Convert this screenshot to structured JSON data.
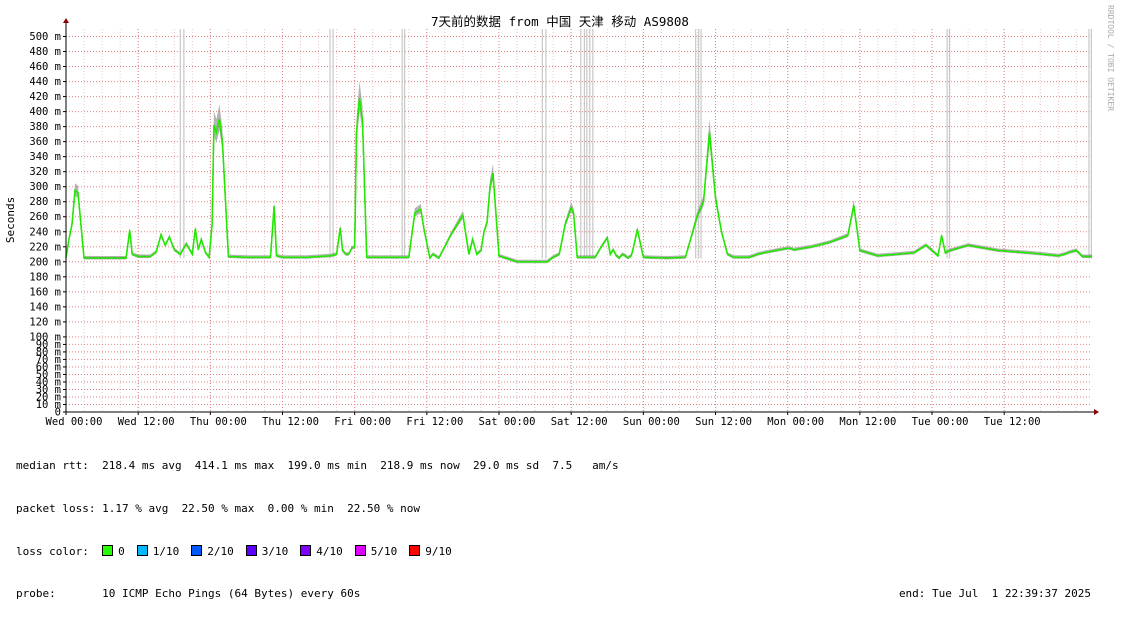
{
  "chart_data": {
    "type": "line",
    "title": "7天前的数据 from 中国 天津 移动 AS9808",
    "ylabel": "Seconds",
    "xlabel": "",
    "watermark": "RRDTOOL / TOBI OETIKER",
    "ylim": [
      0,
      510
    ],
    "yticks": [
      0,
      10,
      20,
      30,
      40,
      50,
      60,
      70,
      80,
      90,
      100,
      120,
      140,
      160,
      180,
      200,
      220,
      240,
      260,
      280,
      300,
      320,
      340,
      360,
      380,
      400,
      420,
      440,
      460,
      480,
      500
    ],
    "ytick_labels": [
      "0",
      "10 m",
      "20 m",
      "30 m",
      "40 m",
      "50 m",
      "60 m",
      "70 m",
      "80 m",
      "90 m",
      "100 m",
      "120 m",
      "140 m",
      "160 m",
      "180 m",
      "200 m",
      "220 m",
      "240 m",
      "260 m",
      "280 m",
      "300 m",
      "320 m",
      "340 m",
      "360 m",
      "380 m",
      "400 m",
      "420 m",
      "440 m",
      "460 m",
      "480 m",
      "500 m"
    ],
    "xlim_hours": [
      0,
      170.6
    ],
    "xticks_hours": [
      0,
      12,
      24,
      36,
      48,
      60,
      72,
      84,
      96,
      108,
      120,
      132,
      144,
      156
    ],
    "xtick_labels": [
      "Wed 00:00",
      "Wed 12:00",
      "Thu 00:00",
      "Thu 12:00",
      "Fri 00:00",
      "Fri 12:00",
      "Sat 00:00",
      "Sat 12:00",
      "Sun 00:00",
      "Sun 12:00",
      "Mon 00:00",
      "Mon 12:00",
      "Tue 00:00",
      "Tue 12:00"
    ],
    "grid": true,
    "series": [
      {
        "name": "median rtt",
        "unit": "ms",
        "x_hours": [
          0,
          0.5,
          1,
          1.5,
          2,
          3,
          5,
          7,
          9,
          10,
          10.6,
          11,
          12,
          14,
          15,
          15.8,
          16.5,
          17.2,
          18,
          19,
          20,
          21,
          21.5,
          22,
          22.5,
          23.2,
          23.8,
          24.3,
          24.6,
          25,
          25.5,
          26,
          27,
          30,
          34,
          34.6,
          35,
          36,
          40,
          44,
          45,
          45.6,
          46,
          46.5,
          47,
          47.5,
          48,
          48.3,
          48.8,
          49.3,
          50,
          53,
          57,
          58,
          59,
          59.5,
          60,
          60.5,
          61,
          62,
          64,
          66,
          67,
          67.6,
          68.3,
          69,
          69.5,
          70,
          70.5,
          71,
          72,
          75,
          80,
          81,
          82,
          83,
          84,
          84.4,
          85,
          88,
          89,
          90,
          90.5,
          91,
          91.5,
          92,
          92.5,
          93,
          93.4,
          94,
          94.5,
          95,
          96,
          100,
          103,
          105,
          106,
          107,
          108,
          109,
          110,
          111,
          112,
          112.5,
          113,
          113.5,
          114,
          115,
          116,
          120,
          120.4,
          121,
          124,
          127,
          130,
          131,
          132,
          135,
          141,
          143,
          145,
          145.6,
          146.2,
          147,
          150,
          155,
          160,
          165,
          166,
          167,
          168,
          169,
          170,
          170.6
        ],
        "values": [
          205,
          230,
          250,
          295,
          292,
          205,
          205,
          205,
          205,
          205,
          242,
          210,
          207,
          207,
          213,
          236,
          222,
          233,
          216,
          210,
          224,
          210,
          244,
          216,
          230,
          212,
          206,
          250,
          382,
          372,
          390,
          360,
          207,
          206,
          206,
          274,
          208,
          206,
          206,
          208,
          210,
          245,
          215,
          210,
          210,
          218,
          220,
          372,
          418,
          388,
          206,
          206,
          206,
          265,
          270,
          245,
          225,
          205,
          210,
          205,
          236,
          262,
          210,
          230,
          210,
          215,
          240,
          252,
          300,
          318,
          208,
          200,
          200,
          206,
          210,
          250,
          272,
          265,
          206,
          206,
          220,
          232,
          210,
          216,
          208,
          205,
          210,
          208,
          205,
          208,
          224,
          243,
          206,
          205,
          206,
          262,
          280,
          372,
          285,
          240,
          210,
          206,
          206,
          206,
          206,
          206,
          207,
          210,
          212,
          218,
          218,
          216,
          220,
          226,
          235,
          275,
          215,
          208,
          212,
          222,
          208,
          235,
          212,
          215,
          222,
          215,
          212,
          208,
          210,
          213,
          215,
          207,
          207,
          207,
          205,
          205
        ]
      }
    ],
    "loss_spike_hours": [
      19,
      19.6,
      43.9,
      44.4,
      55.9,
      56.3,
      79.2,
      79.8,
      85.6,
      86.2,
      86.6,
      87.1,
      87.6,
      104.7,
      105.2,
      105.6,
      146.5,
      146.9,
      170.1,
      170.5
    ]
  },
  "legend": {
    "median_rtt": "median rtt:  218.4 ms avg  414.1 ms max  199.0 ms min  218.9 ms now  29.0 ms sd  7.5   am/s",
    "packet_loss": "packet loss: 1.17 % avg  22.50 % max  0.00 % min  22.50 % now",
    "loss_color_label": "loss color:",
    "loss_colors": [
      {
        "label": "0",
        "color": "#26ff00"
      },
      {
        "label": "1/10",
        "color": "#00b8ff"
      },
      {
        "label": "2/10",
        "color": "#0059ff"
      },
      {
        "label": "3/10",
        "color": "#5e00ff"
      },
      {
        "label": "4/10",
        "color": "#7e00ff"
      },
      {
        "label": "5/10",
        "color": "#dd00ff"
      },
      {
        "label": "9/10",
        "color": "#ff0000"
      }
    ],
    "probe": "probe:       10 ICMP Echo Pings (64 Bytes) every 60s",
    "end": "end: Tue Jul  1 22:39:37 2025"
  },
  "colors": {
    "grid_minor": "#e8c8c8",
    "grid_major": "#e08080",
    "axis": "#000000",
    "arrow": "#8b0000",
    "median_line": "#26ff00",
    "smoke": "#9a9a9a",
    "loss_spike": "#c8c8c8"
  }
}
